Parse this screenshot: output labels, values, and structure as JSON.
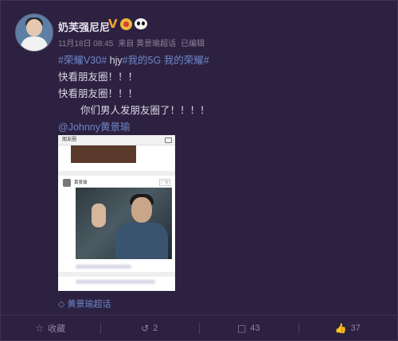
{
  "post": {
    "author": "奶芙强尼尼",
    "timestamp": "11月18日 08:45",
    "source": "来自 黄景瑜超话",
    "edited": "已编辑",
    "hashtag1": "#荣耀V30#",
    "text1_mid": " hjy",
    "hashtag2": "#我的5G 我的荣耀#",
    "line2": "快看朋友圈！！！",
    "line3": "快看朋友圈！！！",
    "line4": "你们男人发朋友圈了！！！！",
    "mention": "@Johnny黄景瑜",
    "topic_link": "黄景瑜超话"
  },
  "screenshot": {
    "bar_title": "朋友圈",
    "poster_name": "黄景瑜",
    "ad_label": "广告"
  },
  "footer": {
    "collect_label": "收藏",
    "repost_count": "2",
    "comment_count": "43",
    "like_count": "37"
  },
  "icons": {
    "verified": "verified-v-icon",
    "level": "level-badge-icon",
    "panda": "panda-icon",
    "star": "star-icon",
    "repost": "repost-icon",
    "comment": "comment-icon",
    "like": "thumbs-up-icon",
    "topic": "topic-link-icon"
  },
  "colors": {
    "background": "#2c2140",
    "link": "#6e87c9",
    "text": "#dcd7e6",
    "muted": "#8a8299",
    "verified": "#f2a22a"
  }
}
